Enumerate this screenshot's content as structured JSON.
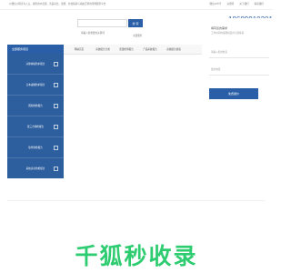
{
  "topbar": {
    "description": "以微信小程序为入口，提供用户反馈、竞品对比、监测、文档指南与系统迁移的评测服务平台",
    "links": [
      "微信公众号",
      "关键词",
      "关于我们",
      "联系我们"
    ]
  },
  "search": {
    "placeholder": "请输入您想要的关键词",
    "button_label": "搜 索"
  },
  "hot_phone": {
    "label": "全国咨询热线",
    "number": "18689910301"
  },
  "menu_badge": "主要服务",
  "nav": {
    "all_label": "全部服务项目",
    "items": [
      "网站首页",
      "系统报告分类",
      "质量检测报告",
      "产品系统报告",
      "系统报告模版"
    ]
  },
  "sidebar": {
    "items": [
      {
        "label": "兴隆城墙防护报告"
      },
      {
        "label": "日本桌桶防护报告"
      },
      {
        "label": "国际防检报告"
      },
      {
        "label": "第三方防检报告"
      },
      {
        "label": "软件防检报告"
      },
      {
        "label": "系统多余防检报告"
      }
    ]
  },
  "form": {
    "title": "填写您的需求",
    "subtitle": "工作时间内客服将及时与您联系",
    "field_name_placeholder": "请输入您的姓名",
    "field_phone_placeholder": "您的电话",
    "submit_label": "免费报价"
  },
  "watermark": "千狐秒收录",
  "colors": {
    "brand_blue": "#2a5fa8",
    "sidebar_blue": "#2d5e9e",
    "watermark_green": "#2ecc71"
  }
}
